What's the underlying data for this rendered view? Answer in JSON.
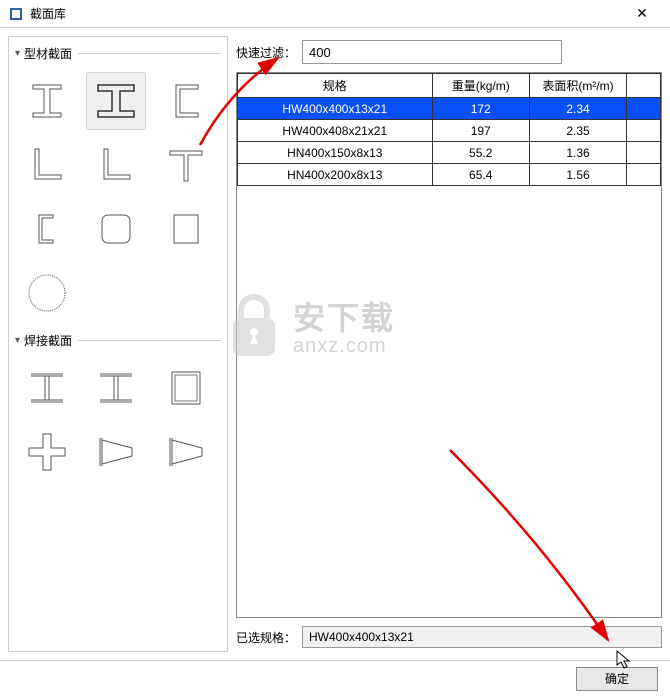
{
  "window": {
    "title": "截面库"
  },
  "sections": {
    "profile": "型材截面",
    "welded": "焊接截面"
  },
  "filter": {
    "label": "快速过滤：",
    "value": "400"
  },
  "table": {
    "headers": {
      "spec": "规格",
      "weight": "重量(kg/m)",
      "area": "表面积(m²/m)"
    },
    "rows": [
      {
        "spec": "HW400x400x13x21",
        "weight": "172",
        "area": "2.34",
        "selected": true
      },
      {
        "spec": "HW400x408x21x21",
        "weight": "197",
        "area": "2.35",
        "selected": false
      },
      {
        "spec": "HN400x150x8x13",
        "weight": "55.2",
        "area": "1.36",
        "selected": false
      },
      {
        "spec": "HN400x200x8x13",
        "weight": "65.4",
        "area": "1.56",
        "selected": false
      }
    ]
  },
  "selected": {
    "label": "已选规格：",
    "value": "HW400x400x13x21"
  },
  "footer": {
    "ok": "确定"
  }
}
